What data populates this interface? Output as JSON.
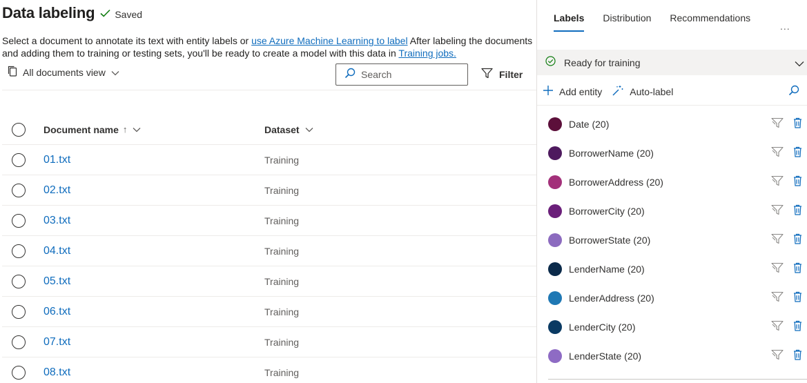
{
  "header": {
    "title": "Data labeling",
    "saved_label": "Saved",
    "description_pre": "Select a document to annotate its text with entity labels or ",
    "description_link1": "use Azure Machine Learning to label",
    "description_mid": "  After labeling the documents and adding them to training or testing sets, you'll be ready to create a model with this data in ",
    "description_link2": "Training jobs."
  },
  "toolbar": {
    "view_label": "All documents view",
    "search_placeholder": "Search",
    "filter_label": "Filter"
  },
  "table": {
    "columns": [
      "Document name",
      "Dataset"
    ],
    "sort_indicator": "↑",
    "rows": [
      {
        "name": "01.txt",
        "dataset": "Training"
      },
      {
        "name": "02.txt",
        "dataset": "Training"
      },
      {
        "name": "03.txt",
        "dataset": "Training"
      },
      {
        "name": "04.txt",
        "dataset": "Training"
      },
      {
        "name": "05.txt",
        "dataset": "Training"
      },
      {
        "name": "06.txt",
        "dataset": "Training"
      },
      {
        "name": "07.txt",
        "dataset": "Training"
      },
      {
        "name": "08.txt",
        "dataset": "Training"
      }
    ]
  },
  "panel": {
    "tabs": [
      "Labels",
      "Distribution",
      "Recommendations"
    ],
    "active_tab": "Labels",
    "more_label": "...",
    "status": "Ready for training",
    "add_entity_label": "Add entity",
    "auto_label_label": "Auto-label",
    "labels": [
      {
        "text": "Date (20)",
        "color": "#5c0f3a"
      },
      {
        "text": "BorrowerName (20)",
        "color": "#4e1a5e"
      },
      {
        "text": "BorrowerAddress (20)",
        "color": "#a3307a"
      },
      {
        "text": "BorrowerCity (20)",
        "color": "#6b1f7a"
      },
      {
        "text": "BorrowerState (20)",
        "color": "#8c6bbf"
      },
      {
        "text": "LenderName (20)",
        "color": "#0b2a4a"
      },
      {
        "text": "LenderAddress (20)",
        "color": "#1f78b4"
      },
      {
        "text": "LenderCity (20)",
        "color": "#0a3a63"
      },
      {
        "text": "LenderState (20)",
        "color": "#8e6bc4"
      }
    ]
  },
  "colors": {
    "link": "#0f6cbd",
    "status_ok": "#107c10",
    "icon_blue": "#0f6cbd",
    "icon_gray": "#8a8886"
  }
}
